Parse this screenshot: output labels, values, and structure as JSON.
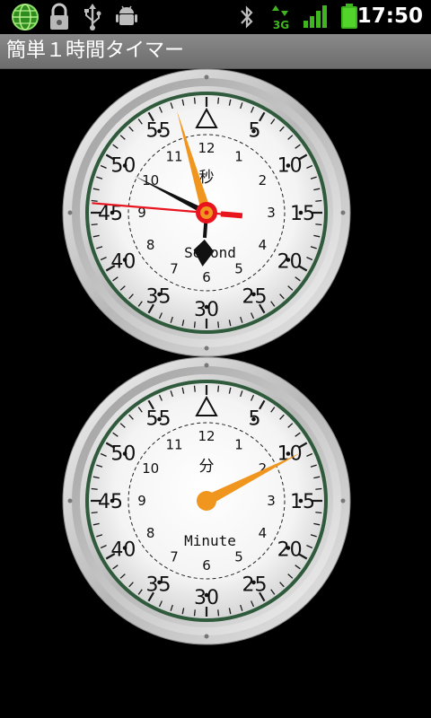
{
  "status_bar": {
    "time": "17:50",
    "network_type": "3G",
    "icons": [
      "globe-icon",
      "lock-icon",
      "usb-icon",
      "android-debug-icon",
      "bluetooth-icon",
      "signal-3g-icon",
      "signal-strength-icon",
      "battery-icon"
    ]
  },
  "app": {
    "title": "簡単１時間タイマー"
  },
  "seconds_dial": {
    "kanji": "秒",
    "unit": "Second",
    "outer_numbers": [
      "5",
      "10",
      "15",
      "20",
      "25",
      "30",
      "35",
      "40",
      "45",
      "50",
      "55"
    ],
    "inner_numbers": [
      "12",
      "1",
      "2",
      "3",
      "4",
      "5",
      "6",
      "7",
      "8",
      "9",
      "10",
      "11"
    ],
    "hand_values": {
      "orange_minutes": 57.3,
      "black_hour_hand": 9.9,
      "black_minute_hand": 30.7,
      "red_second_hand": 15.8
    }
  },
  "minutes_dial": {
    "kanji": "分",
    "unit": "Minute",
    "outer_numbers": [
      "5",
      "10",
      "15",
      "20",
      "25",
      "30",
      "35",
      "40",
      "45",
      "50",
      "55"
    ],
    "inner_numbers": [
      "12",
      "1",
      "2",
      "3",
      "4",
      "5",
      "6",
      "7",
      "8",
      "9",
      "10",
      "11"
    ],
    "hand_values": {
      "orange_minutes": 10.5
    }
  },
  "colors": {
    "accent_orange": "#f0961e",
    "second_red": "#e8141e",
    "hand_black": "#111111",
    "ring_green": "#2f5a3c"
  }
}
